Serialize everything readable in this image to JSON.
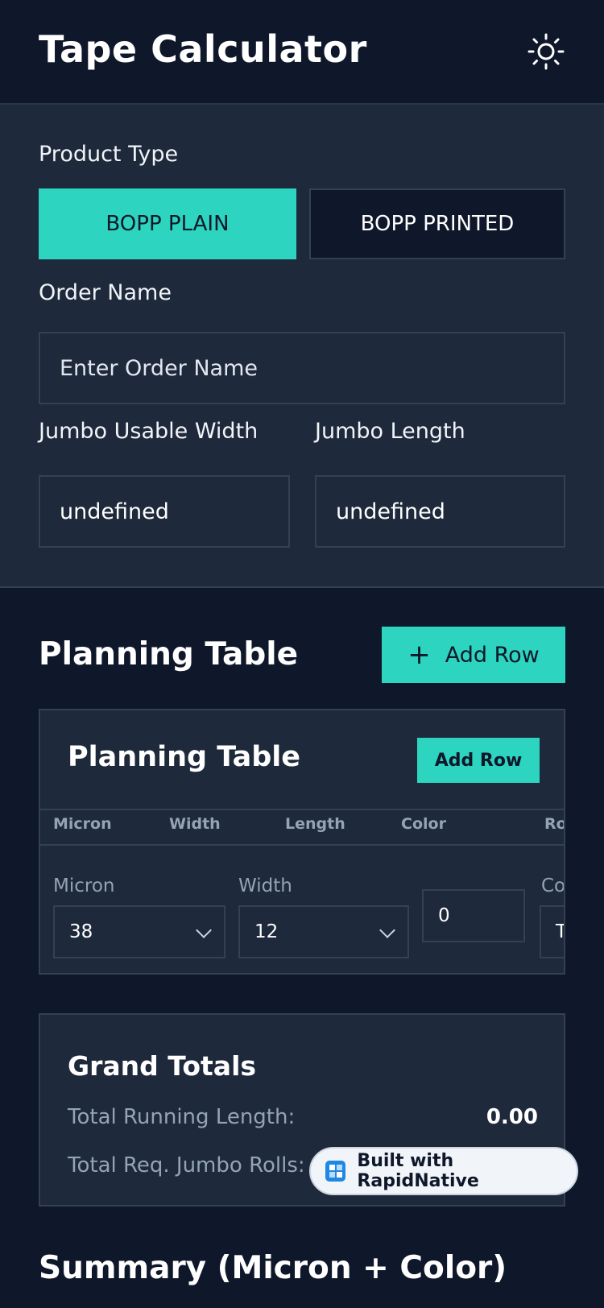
{
  "header": {
    "title": "Tape Calculator",
    "theme_icon": "sun-icon"
  },
  "config": {
    "product_type_label": "Product Type",
    "product_types": [
      "BOPP PLAIN",
      "BOPP PRINTED"
    ],
    "selected_product_type": "BOPP PLAIN",
    "order_name_label": "Order Name",
    "order_name_placeholder": "Enter Order Name",
    "order_name_value": "",
    "jumbo_width_label": "Jumbo Usable Width",
    "jumbo_width_value": "undefined",
    "jumbo_length_label": "Jumbo Length",
    "jumbo_length_value": "undefined"
  },
  "planning": {
    "section_title": "Planning Table",
    "add_row_label": "Add Row",
    "card_title": "Planning Table",
    "card_add_row_label": "Add Row",
    "columns": [
      "Micron",
      "Width",
      "Length",
      "Color",
      "Ro"
    ],
    "row": {
      "micron_label": "Micron",
      "micron_value": "38",
      "width_label": "Width",
      "width_value": "12",
      "length_value": "0",
      "color_label": "Co",
      "color_value": "T"
    }
  },
  "totals": {
    "title": "Grand Totals",
    "running_length_label": "Total Running Length:",
    "running_length_value": "0.00",
    "jumbo_rolls_label": "Total Req. Jumbo Rolls:"
  },
  "badge": {
    "label": "Built with RapidNative"
  },
  "summary": {
    "title": "Summary (Micron + Color)"
  },
  "colors": {
    "accent": "#2dd4bf",
    "background": "#0f172a",
    "panel": "#1e293b",
    "border": "#334155"
  }
}
